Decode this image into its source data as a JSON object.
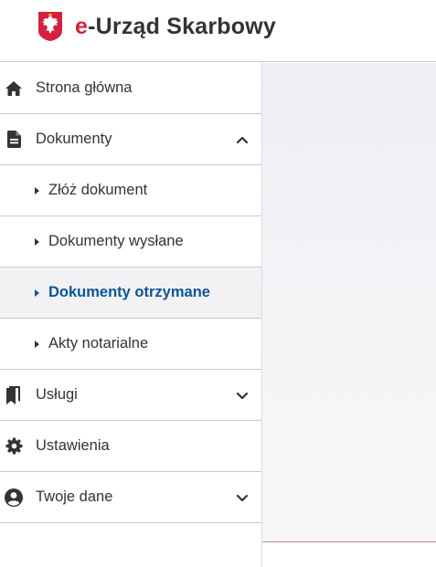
{
  "header": {
    "brand_prefix": "e",
    "title_rest": "-Urząd Skarbowy",
    "logo_icon": "polish-eagle-emblem"
  },
  "colors": {
    "brand_red": "#d4213d",
    "active_blue": "#0c5596",
    "text": "#333333"
  },
  "sidebar": {
    "items": [
      {
        "label": "Strona główna",
        "icon": "home-icon"
      },
      {
        "label": "Dokumenty",
        "icon": "document-icon",
        "expanded": true
      },
      {
        "label": "Złóż dokument",
        "sub": true
      },
      {
        "label": "Dokumenty wysłane",
        "sub": true
      },
      {
        "label": "Dokumenty otrzymane",
        "sub": true,
        "active": true
      },
      {
        "label": "Akty notarialne",
        "sub": true
      },
      {
        "label": "Usługi",
        "icon": "bookmarks-icon",
        "expanded": false
      },
      {
        "label": "Ustawienia",
        "icon": "gear-icon"
      },
      {
        "label": "Twoje dane",
        "icon": "user-icon",
        "expanded": false
      }
    ]
  }
}
